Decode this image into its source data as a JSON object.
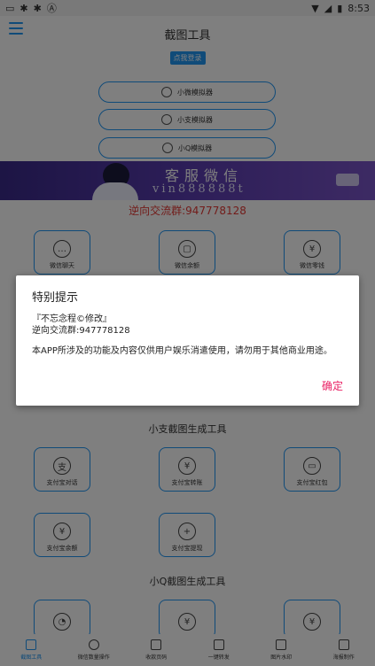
{
  "status": {
    "time": "8:53"
  },
  "header": {
    "title": "截图工具"
  },
  "login_badge": "点我登录",
  "simulators": [
    {
      "label": "小微模拟器"
    },
    {
      "label": "小支模拟器"
    },
    {
      "label": "小Q模拟器"
    }
  ],
  "banner": {
    "title": "客服微信",
    "subtitle": "vin888888t"
  },
  "qq_group": "逆向交流群:947778128",
  "wechat_tiles": [
    {
      "label": "微信聊天"
    },
    {
      "label": "微信余额"
    },
    {
      "label": "微信零钱"
    }
  ],
  "alipay_section": {
    "title": "小支截图生成工具"
  },
  "alipay_tiles": [
    {
      "label": "支付宝对话"
    },
    {
      "label": "支付宝转账"
    },
    {
      "label": "支付宝红包"
    },
    {
      "label": "支付宝余额"
    },
    {
      "label": "支付宝提现"
    }
  ],
  "qq_section": {
    "title": "小Q截图生成工具"
  },
  "bottom_nav": [
    {
      "label": "截图工具"
    },
    {
      "label": "微信数量操作"
    },
    {
      "label": "收款页码"
    },
    {
      "label": "一键转发"
    },
    {
      "label": "图片水印"
    },
    {
      "label": "海报制作"
    }
  ],
  "dialog": {
    "title": "特别提示",
    "line1": "『不忘念程©修改』",
    "line2": "逆向交流群:947778128",
    "message": "本APP所涉及的功能及内容仅供用户娱乐消遣使用，请勿用于其他商业用途。",
    "ok": "确定"
  }
}
